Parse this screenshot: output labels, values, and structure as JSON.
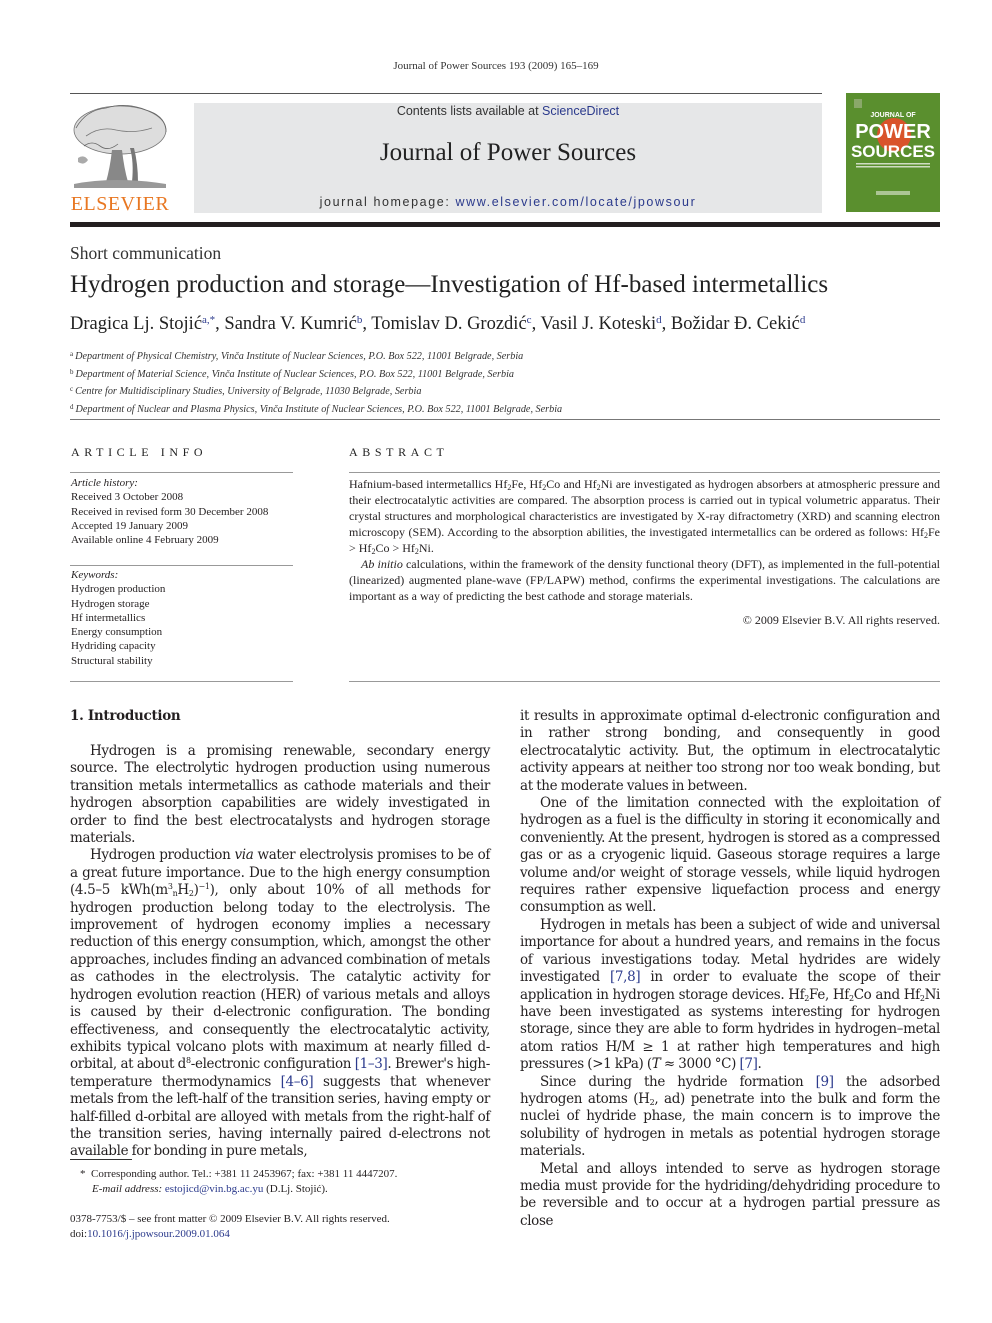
{
  "running_head": "Journal of Power Sources 193 (2009) 165–169",
  "masthead": {
    "publisher": "ELSEVIER",
    "contents_prefix": "Contents lists available at ",
    "contents_link": "ScienceDirect",
    "journal_title": "Journal of Power Sources",
    "homepage_prefix": "journal homepage: ",
    "homepage_url": "www.elsevier.com/locate/jpowsour",
    "cover": {
      "line1": "JOURNAL OF",
      "line2": "POWER",
      "line3": "SOURCES",
      "bg_color": "#5a8f2e",
      "accent_color": "#d9532b"
    },
    "logo_color": "#e87722"
  },
  "article": {
    "type": "Short communication",
    "title": "Hydrogen production and storage—Investigation of Hf-based intermetallics",
    "authors": [
      {
        "name": "Dragica Lj. Stojić",
        "marks": "a,*"
      },
      {
        "name": "Sandra V. Kumrić",
        "marks": "b"
      },
      {
        "name": "Tomislav D. Grozdić",
        "marks": "c"
      },
      {
        "name": "Vasil J. Koteski",
        "marks": "d"
      },
      {
        "name": "Božidar Đ. Cekić",
        "marks": "d"
      }
    ],
    "affiliations": [
      {
        "mark": "a",
        "text": "Department of Physical Chemistry, Vinča Institute of Nuclear Sciences, P.O. Box 522, 11001 Belgrade, Serbia"
      },
      {
        "mark": "b",
        "text": "Department of Material Science, Vinča Institute of Nuclear Sciences, P.O. Box 522, 11001 Belgrade, Serbia"
      },
      {
        "mark": "c",
        "text": "Centre for Multidisciplinary Studies, University of Belgrade, 11030 Belgrade, Serbia"
      },
      {
        "mark": "d",
        "text": "Department of Nuclear and Plasma Physics, Vinča Institute of Nuclear Sciences, P.O. Box 522, 11001 Belgrade, Serbia"
      }
    ]
  },
  "article_info": {
    "heading": "ARTICLE INFO",
    "history_label": "Article history:",
    "history": [
      "Received 3 October 2008",
      "Received in revised form 30 December 2008",
      "Accepted 19 January 2009",
      "Available online 4 February 2009"
    ],
    "keywords_label": "Keywords:",
    "keywords": [
      "Hydrogen production",
      "Hydrogen storage",
      "Hf intermetallics",
      "Energy consumption",
      "Hydriding capacity",
      "Structural stability"
    ]
  },
  "abstract": {
    "heading": "ABSTRACT",
    "p1": [
      "Hafnium-based intermetallics Hf",
      "2",
      "Fe, Hf",
      "2",
      "Co and Hf",
      "2",
      "Ni are investigated as hydrogen absorbers at atmospheric pressure and their electrocatalytic activities are compared. The absorption process is carried out in typical volumetric apparatus. Their crystal structures and morphological characteristics are investigated by X-ray difractometry (XRD) and scanning electron microscopy (SEM). According to the absorption abilities, the investigated intermetallics can be ordered as follows: Hf",
      "2",
      "Fe > Hf",
      "2",
      "Co > Hf",
      "2",
      "Ni."
    ],
    "p2_italic": "Ab initio",
    "p2": " calculations, within the framework of the density functional theory (DFT), as implemented in the full-potential (linearized) augmented plane-wave (FP/LAPW) method, confirms the experimental investigations. The calculations are important as a way of predicting the best cathode and storage materials.",
    "copyright": "© 2009 Elsevier B.V. All rights reserved."
  },
  "body": {
    "section_heading": "1.  Introduction",
    "left": {
      "p1": "Hydrogen is a promising renewable, secondary energy source. The electrolytic hydrogen production using numerous transition metals intermetallics as cathode materials and their hydrogen absorption capabilities are widely investigated in order to find the best electrocatalysts and hydrogen storage materials.",
      "p2_a": "Hydrogen production ",
      "p2_via": "via",
      "p2_b": " water electrolysis promises to be of a great future importance. Due to the high energy consumption (4.5–5 kWh(m",
      "p2_sup3": "3",
      "p2_subn": "n",
      "p2_c": "H",
      "p2_sub2": "2",
      "p2_d": ")",
      "p2_supm1": "−1",
      "p2_e": "), only about 10% of all methods for hydrogen production belong today to the electrolysis. The improvement of hydrogen economy implies a necessary reduction of this energy consumption, which, amongst the other approaches, includes finding an advanced combination of metals as cathodes in the electrolysis. The catalytic activity for hydrogen evolution reaction (HER) of various metals and alloys is caused by their d-electronic configuration. The bonding effectiveness, and consequently the electrocatalytic activity, exhibits typical volcano plots with maximum at nearly filled d-orbital, at about d",
      "p2_sup8": "8",
      "p2_f": "-electronic configuration ",
      "ref_1_3": "[1–3]",
      "p2_g": ". Brewer's high-temperature thermodynamics ",
      "ref_4_6": "[4–6]",
      "p2_h": " suggests that whenever metals from the left-half of the transition series, having empty or half-filled d-orbital are alloyed with metals from the right-half of the transition series, having internally paired d-electrons not available for bonding in pure metals,"
    },
    "right": {
      "p0": "it results in approximate optimal d-electronic configuration and in rather strong bonding, and consequently in good electrocatalytic activity. But, the optimum in electrocatalytic activity appears at neither too strong nor too weak bonding, but at the moderate values in between.",
      "p1": "One of the limitation connected with the exploitation of hydrogen as a fuel is the difficulty in storing it economically and conveniently. At the present, hydrogen is stored as a compressed gas or as a cryogenic liquid. Gaseous storage requires a large volume and/or weight of storage vessels, while liquid hydrogen requires rather expensive liquefaction process and energy consumption as well.",
      "p2_a": "Hydrogen in metals has been a subject of wide and universal importance for about a hundred years, and remains in the focus of various investigations today. Metal hydrides are widely investigated ",
      "ref_7_8": "[7,8]",
      "p2_b": " in order to evaluate the scope of their application in hydrogen storage devices. Hf",
      "p2_c": "Fe, Hf",
      "p2_d": "Co and Hf",
      "p2_e": "Ni have been investigated as systems interesting for hydrogen storage, since they are able to form hydrides in hydrogen–metal atom ratios H/M ≥ 1 at rather high temperatures and high pressures (>1 kPa) (",
      "p2_T": "T",
      "p2_f": " ≈ 3000 °C) ",
      "ref_7": "[7]",
      "p2_g": ".",
      "sub2": "2",
      "p3_a": "Since during the hydride formation ",
      "ref_9": "[9]",
      "p3_b": " the adsorbed hydrogen atoms (H",
      "p3_c": ", ad) penetrate into the bulk and form the nuclei of hydride phase, the main concern is to improve the solubility of hydrogen in metals as potential hydrogen storage materials.",
      "p4": "Metal and alloys intended to serve as hydrogen storage media must provide for the hydriding/dehydriding procedure to be reversible and to occur at a hydrogen partial pressure as close"
    }
  },
  "footnotes": {
    "star": "*",
    "corresponding": "Corresponding author. Tel.: +381 11 2453967; fax: +381 11 4447207.",
    "email_label": "E-mail address:",
    "email": "estojicd@vin.bg.ac.yu",
    "email_suffix": " (D.Lj. Stojić).",
    "issn_line": "0378-7753/$ – see front matter © 2009 Elsevier B.V. All rights reserved.",
    "doi_prefix": "doi:",
    "doi": "10.1016/j.jpowsour.2009.01.064"
  }
}
